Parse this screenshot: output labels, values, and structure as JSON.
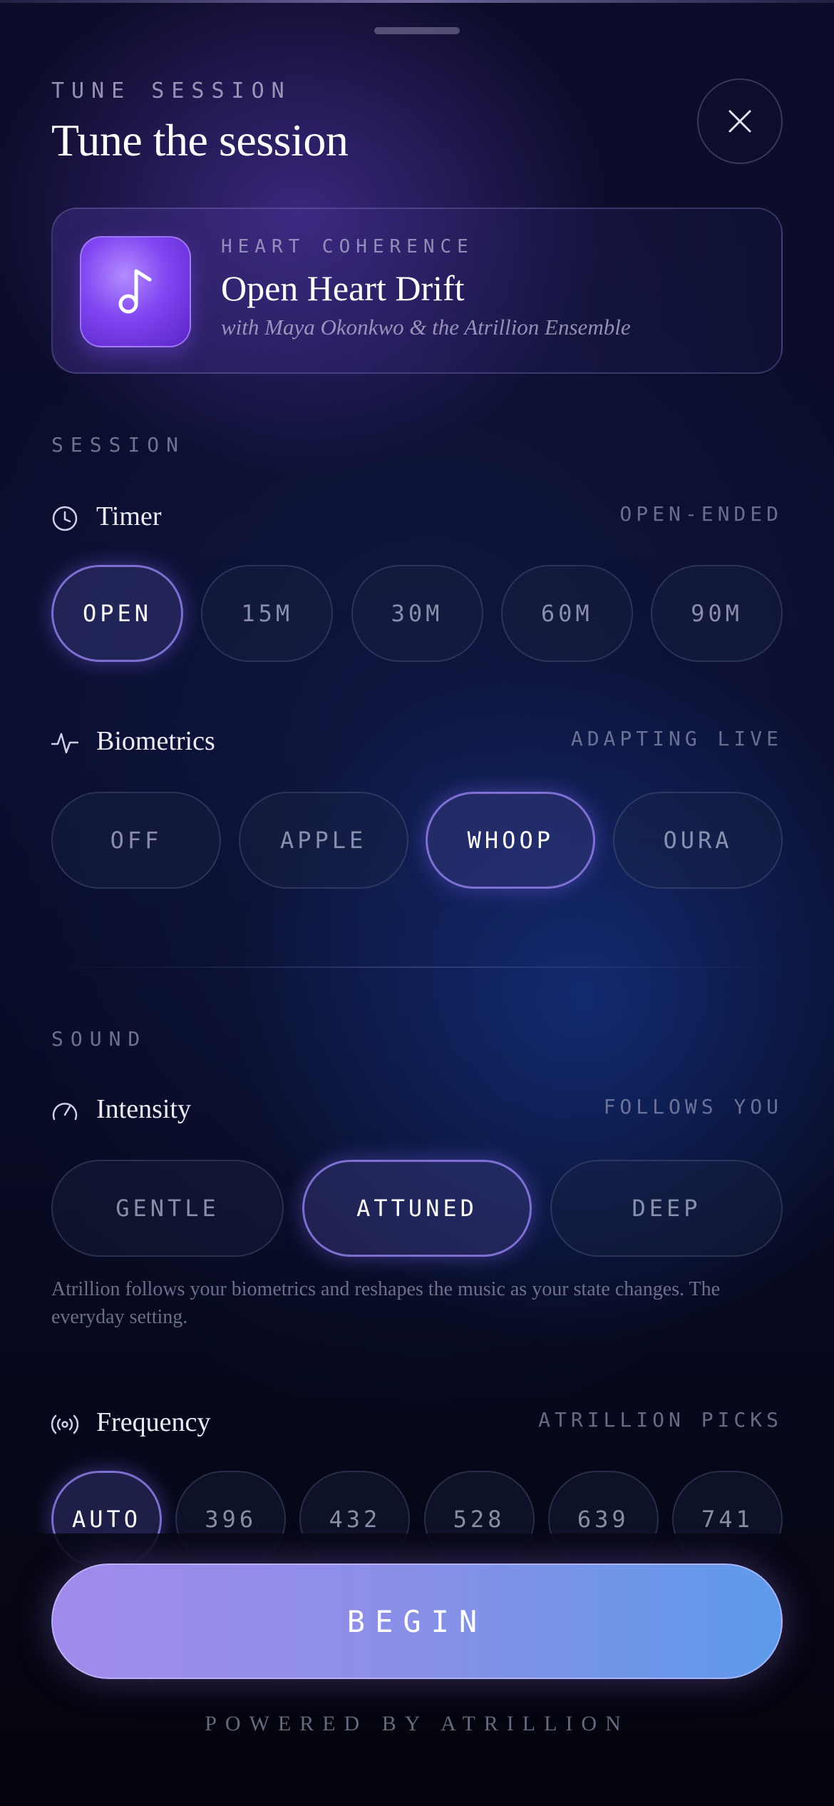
{
  "header": {
    "eyebrow": "TUNE SESSION",
    "title": "Tune the session",
    "close_icon": "close-icon"
  },
  "track": {
    "kicker": "HEART COHERENCE",
    "title": "Open Heart Drift",
    "subtitle": "with Maya Okonkwo & the Atrillion Ensemble",
    "art_icon": "music-note-icon"
  },
  "session": {
    "label": "SESSION",
    "timer": {
      "icon": "clock-icon",
      "label": "Timer",
      "status": "OPEN-ENDED",
      "options": [
        "OPEN",
        "15M",
        "30M",
        "60M",
        "90M"
      ],
      "selected": "OPEN"
    },
    "biometrics": {
      "icon": "pulse-icon",
      "label": "Biometrics",
      "status": "ADAPTING LIVE",
      "options": [
        "OFF",
        "APPLE",
        "WHOOP",
        "OURA"
      ],
      "selected": "WHOOP"
    }
  },
  "sound": {
    "label": "SOUND",
    "intensity": {
      "icon": "gauge-icon",
      "label": "Intensity",
      "status": "FOLLOWS YOU",
      "options": [
        "GENTLE",
        "ATTUNED",
        "DEEP"
      ],
      "selected": "ATTUNED",
      "helper": "Atrillion follows your biometrics and reshapes the music as your state changes. The everyday setting."
    },
    "frequency": {
      "icon": "broadcast-icon",
      "label": "Frequency",
      "status": "ATRILLION PICKS",
      "options": [
        "AUTO",
        "396",
        "432",
        "528",
        "639",
        "741"
      ],
      "selected": "AUTO"
    }
  },
  "footer": {
    "begin_label": "BEGIN",
    "powered_by": "POWERED BY ATRILLION"
  },
  "colors": {
    "accent": "#8c8fe8",
    "begin_start": "#a18aec",
    "begin_end": "#5e9aea",
    "album": "#8046f2"
  }
}
